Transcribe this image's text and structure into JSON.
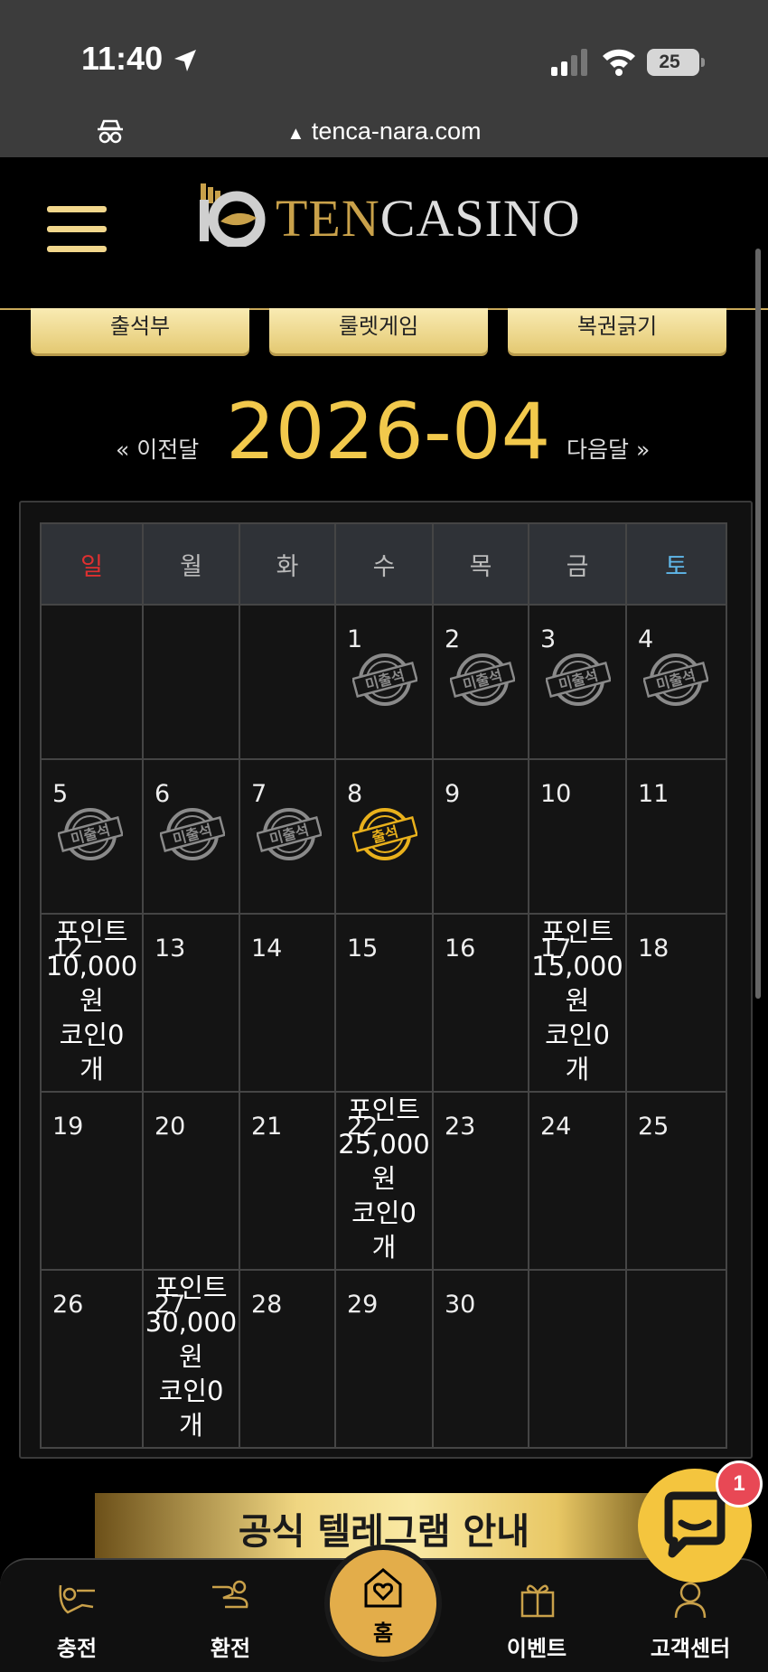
{
  "status": {
    "time": "11:40",
    "battery": "25"
  },
  "browser": {
    "url": "tenca-nara.com"
  },
  "header": {
    "brand_ten": "TEN",
    "brand_casino": "CASINO"
  },
  "tabs": [
    {
      "label": "출석부"
    },
    {
      "label": "룰렛게임"
    },
    {
      "label": "복권긁기"
    }
  ],
  "calendar": {
    "month": "2026-04",
    "prev_label": "« 이전달",
    "next_label": "다음달 »",
    "weekdays": [
      "일",
      "월",
      "화",
      "수",
      "목",
      "금",
      "토"
    ],
    "weekday_colors": {
      "sunday": "#e03030",
      "saturday": "#5fb6e8",
      "default": "#bbbbbb"
    },
    "weeks": [
      [
        {
          "day": ""
        },
        {
          "day": ""
        },
        {
          "day": ""
        },
        {
          "day": "1",
          "stamp": "미출석"
        },
        {
          "day": "2",
          "stamp": "미출석"
        },
        {
          "day": "3",
          "stamp": "미출석"
        },
        {
          "day": "4",
          "stamp": "미출석"
        }
      ],
      [
        {
          "day": "5",
          "stamp": "미출석"
        },
        {
          "day": "6",
          "stamp": "미출석"
        },
        {
          "day": "7",
          "stamp": "미출석"
        },
        {
          "day": "8",
          "stamp": "출석"
        },
        {
          "day": "9"
        },
        {
          "day": "10"
        },
        {
          "day": "11"
        }
      ],
      [
        {
          "day": "12",
          "reward": [
            "포인트",
            "10,000",
            "원",
            "코인0",
            "개"
          ]
        },
        {
          "day": "13"
        },
        {
          "day": "14"
        },
        {
          "day": "15"
        },
        {
          "day": "16"
        },
        {
          "day": "17",
          "reward": [
            "포인트",
            "15,000",
            "원",
            "코인0",
            "개"
          ]
        },
        {
          "day": "18"
        }
      ],
      [
        {
          "day": "19"
        },
        {
          "day": "20"
        },
        {
          "day": "21"
        },
        {
          "day": "22",
          "reward": [
            "포인트",
            "25,000",
            "원",
            "코인0",
            "개"
          ]
        },
        {
          "day": "23"
        },
        {
          "day": "24"
        },
        {
          "day": "25"
        }
      ],
      [
        {
          "day": "26"
        },
        {
          "day": "27",
          "reward": [
            "포인트",
            "30,000",
            "원",
            "코인0",
            "개"
          ]
        },
        {
          "day": "28"
        },
        {
          "day": "29"
        },
        {
          "day": "30"
        },
        {
          "day": ""
        },
        {
          "day": ""
        }
      ]
    ]
  },
  "banner": {
    "text": "공식 텔레그램 안내"
  },
  "bottom_nav": {
    "charge": "충전",
    "exchange": "환전",
    "home": "홈",
    "event": "이벤트",
    "support": "고객센터"
  },
  "chat": {
    "badge": "1"
  },
  "colors": {
    "gold": "#f2c94c",
    "tab_gold": "#e4c972",
    "stamp_gold": "#e9b11c",
    "stamp_grey": "#8a8a8a"
  }
}
